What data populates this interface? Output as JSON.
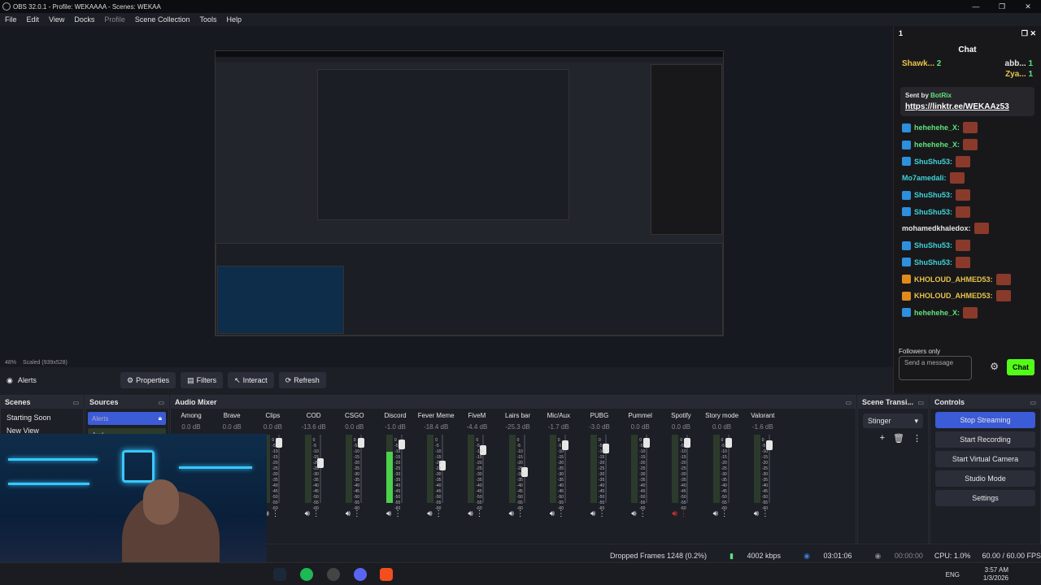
{
  "window": {
    "title": "OBS 32.0.1 - Profile: WEKAAAA - Scenes: WEKAA",
    "min": "—",
    "max": "❐",
    "close": "✕"
  },
  "menu": [
    "File",
    "Edit",
    "View",
    "Docks",
    "Profile",
    "Scene Collection",
    "Tools",
    "Help"
  ],
  "preview": {
    "zoom": "48%",
    "scaled": "Scaled (939x528)"
  },
  "chat": {
    "tab_number": "1",
    "title": "Chat",
    "leaders": [
      {
        "name": "Shawk...",
        "count": "2"
      },
      {
        "name": "abb...",
        "count": "1"
      },
      {
        "name": "Zya...",
        "count": "1"
      }
    ],
    "pinned": {
      "prefix": "Sent by",
      "author": "BotRix",
      "link": "https://linktr.ee/WEKAAz53"
    },
    "messages": [
      {
        "user": "hehehehe_X:",
        "color": "green",
        "badge": "blue"
      },
      {
        "user": "hehehehe_X:",
        "color": "green",
        "badge": "blue"
      },
      {
        "user": "ShuShu53:",
        "color": "cyan",
        "badge": "blue"
      },
      {
        "user": "Mo7amedali:",
        "color": "cyan",
        "badge": ""
      },
      {
        "user": "ShuShu53:",
        "color": "cyan",
        "badge": "blue"
      },
      {
        "user": "ShuShu53:",
        "color": "cyan",
        "badge": "blue"
      },
      {
        "user": "mohamedkhaledox:",
        "color": "white",
        "badge": ""
      },
      {
        "user": "ShuShu53:",
        "color": "cyan",
        "badge": "blue"
      },
      {
        "user": "ShuShu53:",
        "color": "cyan",
        "badge": "blue"
      },
      {
        "user": "KHOLOUD_AHMED53:",
        "color": "gold",
        "badge": "orange"
      },
      {
        "user": "KHOLOUD_AHMED53:",
        "color": "gold",
        "badge": "orange"
      },
      {
        "user": "hehehehe_X:",
        "color": "green",
        "badge": "blue"
      }
    ],
    "followers_only": "Followers only",
    "send_placeholder": "Send a message",
    "chat_button": "Chat"
  },
  "source_toolbar": {
    "source": "Alerts",
    "properties": "Properties",
    "filters": "Filters",
    "interact": "Interact",
    "refresh": "Refresh"
  },
  "scenes": {
    "title": "Scenes",
    "items": [
      "Starting Soon",
      "New View"
    ]
  },
  "sources": {
    "title": "Sources",
    "items": [
      "Alerts",
      "Aud"
    ]
  },
  "mixer": {
    "title": "Audio Mixer",
    "channels": [
      {
        "name": "Among",
        "db": "0.0 dB",
        "level": 0,
        "knob": 0.05,
        "muted": false
      },
      {
        "name": "Brave",
        "db": "0.0 dB",
        "level": 0,
        "knob": 0.05,
        "muted": false
      },
      {
        "name": "Clips",
        "db": "0.0 dB",
        "level": 0,
        "knob": 0.05,
        "muted": false
      },
      {
        "name": "COD",
        "db": "-13.6 dB",
        "level": 0,
        "knob": 0.4,
        "muted": false
      },
      {
        "name": "CSGO",
        "db": "0.0 dB",
        "level": 0,
        "knob": 0.05,
        "muted": false
      },
      {
        "name": "Discord",
        "db": "-1.0 dB",
        "level": 0.75,
        "knob": 0.08,
        "muted": false
      },
      {
        "name": "Fever Meme",
        "db": "-18.4 dB",
        "level": 0,
        "knob": 0.45,
        "muted": false
      },
      {
        "name": "FiveM",
        "db": "-4.4 dB",
        "level": 0,
        "knob": 0.18,
        "muted": false
      },
      {
        "name": "Lairs bar",
        "db": "-25.3 dB",
        "level": 0,
        "knob": 0.55,
        "muted": false
      },
      {
        "name": "Mic/Aux",
        "db": "-1.7 dB",
        "level": 0,
        "knob": 0.1,
        "muted": false
      },
      {
        "name": "PUBG",
        "db": "-3.0 dB",
        "level": 0,
        "knob": 0.15,
        "muted": false
      },
      {
        "name": "Pummel",
        "db": "0.0 dB",
        "level": 0,
        "knob": 0.05,
        "muted": false
      },
      {
        "name": "Spotify",
        "db": "0.0 dB",
        "level": 0,
        "knob": 0.05,
        "muted": true
      },
      {
        "name": "Story mode",
        "db": "0.0 dB",
        "level": 0,
        "knob": 0.05,
        "muted": false
      },
      {
        "name": "Valorant",
        "db": "-1.6 dB",
        "level": 0,
        "knob": 0.1,
        "muted": false
      }
    ],
    "scale": [
      "0",
      "-5",
      "-10",
      "-15",
      "-20",
      "-25",
      "-30",
      "-35",
      "-40",
      "-45",
      "-50",
      "-55",
      "-60"
    ]
  },
  "transitions": {
    "title": "Scene Transi...",
    "selected": "Stinger"
  },
  "controls": {
    "title": "Controls",
    "buttons": [
      "Stop Streaming",
      "Start Recording",
      "Start Virtual Camera",
      "Studio Mode",
      "Settings"
    ]
  },
  "status": {
    "dropped": "Dropped Frames 1248 (0.2%)",
    "bitrate": "4002 kbps",
    "stream_time": "03:01:06",
    "rec_time": "00:00:00",
    "cpu": "CPU: 1.0%",
    "fps": "60.00 / 60.00 FPS"
  },
  "tray": {
    "lang": "ENG",
    "time": "3:57 AM",
    "date": "1/3/2026"
  },
  "colors": {
    "accent": "#3c5bd6",
    "kick_green": "#53fc18",
    "meter": "#4bd14b"
  }
}
